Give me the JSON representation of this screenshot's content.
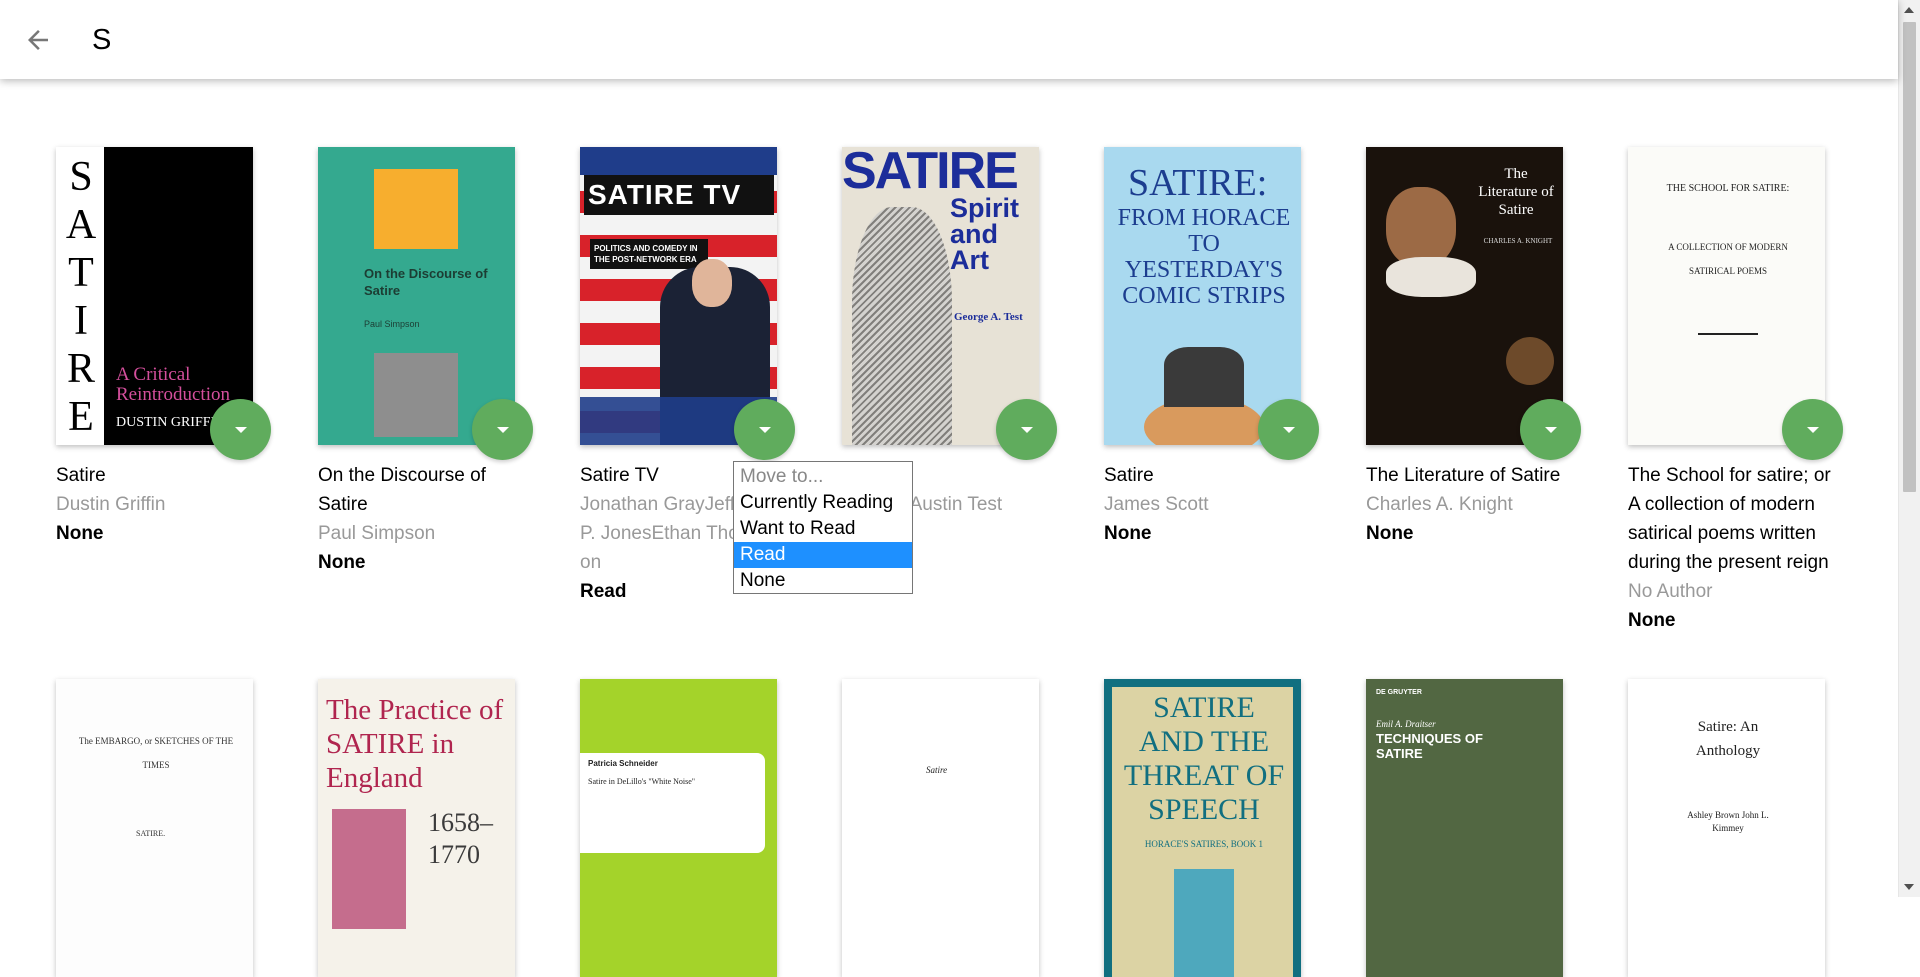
{
  "search": {
    "value": "S",
    "placeholder": ""
  },
  "books_row1": [
    {
      "title": "Satire",
      "authors": "Dustin Griffin",
      "shelf": "None",
      "cover_text": [
        "S",
        "A",
        "T",
        "I",
        "R",
        "E"
      ],
      "cover_sub": "A Critical Reintroduction",
      "cover_author": "DUSTIN GRIFFIN"
    },
    {
      "title": "On the Discourse of Satire",
      "authors": "Paul Simpson",
      "shelf": "None",
      "cover_title": "On the Discourse of Satire",
      "cover_author": "Paul Simpson"
    },
    {
      "title": "Satire TV",
      "authors": "Jonathan GrayJeffrey P. JonesEthan Thompson",
      "shelf": "Read",
      "cover_title": "SATIRE TV",
      "cover_sub": "POLITICS AND COMEDY IN THE POST-NETWORK ERA"
    },
    {
      "title": "Satire",
      "authors": "George Austin Test",
      "shelf": "None",
      "cover_title": "SATIRE",
      "cover_sub": "Spirit and Art",
      "cover_author": "George A. Test"
    },
    {
      "title": "Satire",
      "authors": "James Scott",
      "shelf": "None",
      "cover_title": "SATIRE:",
      "cover_sub": "FROM HORACE TO YESTERDAY'S COMIC STRIPS"
    },
    {
      "title": "The Literature of Satire",
      "authors": "Charles A. Knight",
      "shelf": "None",
      "cover_title": "The Literature of Satire",
      "cover_author": "CHARLES A. KNIGHT"
    },
    {
      "title": "The School for satire; or A collection of modern satirical poems written during the present reign",
      "authors": "No Author",
      "shelf": "None",
      "cover_title": "THE SCHOOL FOR SATIRE:",
      "cover_sub": "A COLLECTION OF MODERN SATIRICAL POEMS"
    }
  ],
  "books_row2": [
    {
      "cover_title": "The EMBARGO, or SKETCHES OF THE TIMES",
      "cover_sub": "SATIRE."
    },
    {
      "cover_title": "The Practice of SATIRE in England",
      "cover_sub": "1658–1770"
    },
    {
      "cover_title": "Patricia Schneider",
      "cover_sub": "Satire in DeLillo's \"White Noise\""
    },
    {
      "cover_title": "Satire"
    },
    {
      "cover_title": "SATIRE AND THE THREAT OF SPEECH",
      "cover_sub": "HORACE'S SATIRES, BOOK 1"
    },
    {
      "cover_title": "TECHNIQUES OF SATIRE",
      "cover_author": "Emil A. Draitser"
    },
    {
      "cover_title": "Satire: An Anthology",
      "cover_author": "Ashley Brown John L. Kimmey"
    }
  ],
  "shelf_menu": {
    "options": [
      "Move to...",
      "Currently Reading",
      "Want to Read",
      "Read",
      "None"
    ],
    "selected": "Read"
  },
  "colors": {
    "shelf_button": "#60ac5d",
    "menu_highlight": "#1e90ff",
    "author_gray": "#999999"
  }
}
